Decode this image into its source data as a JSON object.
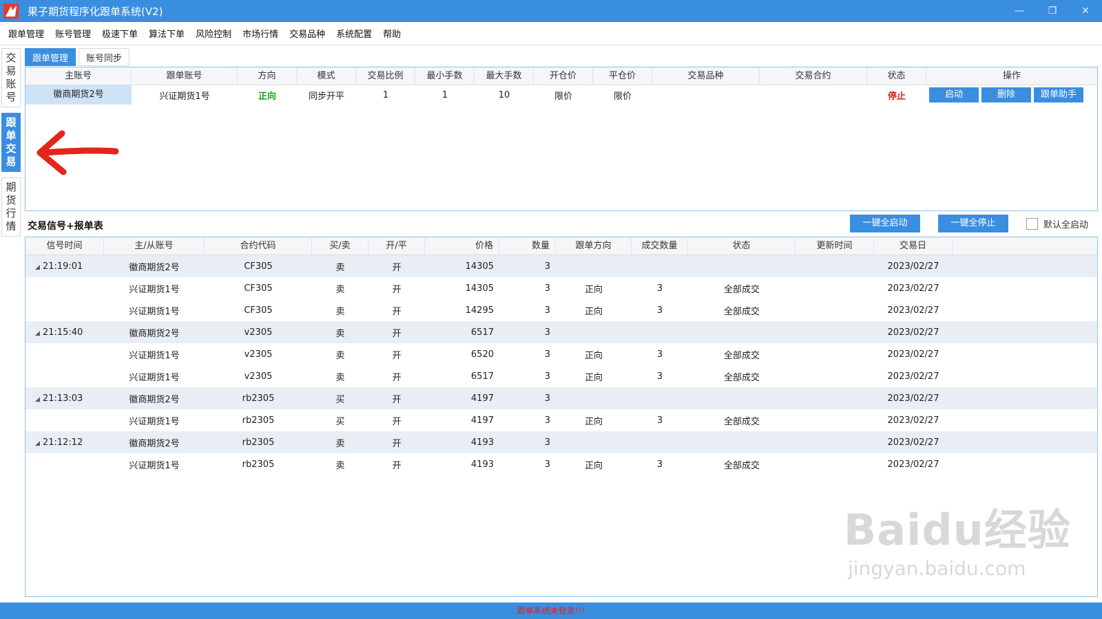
{
  "window": {
    "title": "果子期货程序化跟单系统(V2)",
    "controls": [
      "—",
      "❐",
      "✕"
    ]
  },
  "menu": [
    "跟单管理",
    "账号管理",
    "极速下单",
    "算法下单",
    "风险控制",
    "市场行情",
    "交易品种",
    "系统配置",
    "帮助"
  ],
  "sidebar": [
    {
      "label": [
        "交",
        "易",
        "账",
        "号"
      ],
      "active": false
    },
    {
      "label": [
        "跟",
        "单",
        "交",
        "易"
      ],
      "active": true
    },
    {
      "label": [
        "期",
        "货",
        "行",
        "情"
      ],
      "active": false
    }
  ],
  "tabs": [
    {
      "label": "跟单管理",
      "active": true
    },
    {
      "label": "账号同步",
      "active": false
    }
  ],
  "follow_table": {
    "headers": [
      "主账号",
      "跟单账号",
      "方向",
      "模式",
      "交易比例",
      "最小手数",
      "最大手数",
      "开仓价",
      "平仓价",
      "交易品种",
      "交易合约",
      "状态",
      "操作"
    ],
    "rows": [
      {
        "main": "徽商期货2号",
        "follow": "兴证期货1号",
        "direction": "正向",
        "mode": "同步开平",
        "ratio": "1",
        "min": "1",
        "max": "10",
        "open_price": "限价",
        "close_price": "限价",
        "product": "",
        "contract": "",
        "status": "停止"
      }
    ],
    "op_buttons": [
      "启动",
      "删除",
      "跟单助手"
    ]
  },
  "signal_section": {
    "title": "交易信号+报单表",
    "start_all": "一键全启动",
    "stop_all": "一键全停止",
    "default_start": "默认全启动"
  },
  "signal_table": {
    "headers": [
      "信号时间",
      "主/从账号",
      "合约代码",
      "买/卖",
      "开/平",
      "价格",
      "数量",
      "跟单方向",
      "成交数量",
      "状态",
      "更新时间",
      "交易日"
    ],
    "rows": [
      {
        "parent": true,
        "time": "21:19:01",
        "account": "徽商期货2号",
        "contract": "CF305",
        "bs": "卖",
        "oc": "开",
        "price": "14305",
        "qty": "3",
        "dir": "",
        "filled": "",
        "status": "",
        "update": "",
        "date": "2023/02/27"
      },
      {
        "parent": false,
        "time": "",
        "account": "兴证期货1号",
        "contract": "CF305",
        "bs": "卖",
        "oc": "开",
        "price": "14305",
        "qty": "3",
        "dir": "正向",
        "filled": "3",
        "status": "全部成交",
        "update": "",
        "date": "2023/02/27"
      },
      {
        "parent": false,
        "time": "",
        "account": "兴证期货1号",
        "contract": "CF305",
        "bs": "卖",
        "oc": "开",
        "price": "14295",
        "qty": "3",
        "dir": "正向",
        "filled": "3",
        "status": "全部成交",
        "update": "",
        "date": "2023/02/27"
      },
      {
        "parent": true,
        "time": "21:15:40",
        "account": "徽商期货2号",
        "contract": "v2305",
        "bs": "卖",
        "oc": "开",
        "price": "6517",
        "qty": "3",
        "dir": "",
        "filled": "",
        "status": "",
        "update": "",
        "date": "2023/02/27"
      },
      {
        "parent": false,
        "time": "",
        "account": "兴证期货1号",
        "contract": "v2305",
        "bs": "卖",
        "oc": "开",
        "price": "6520",
        "qty": "3",
        "dir": "正向",
        "filled": "3",
        "status": "全部成交",
        "update": "",
        "date": "2023/02/27"
      },
      {
        "parent": false,
        "time": "",
        "account": "兴证期货1号",
        "contract": "v2305",
        "bs": "卖",
        "oc": "开",
        "price": "6517",
        "qty": "3",
        "dir": "正向",
        "filled": "3",
        "status": "全部成交",
        "update": "",
        "date": "2023/02/27"
      },
      {
        "parent": true,
        "time": "21:13:03",
        "account": "徽商期货2号",
        "contract": "rb2305",
        "bs": "买",
        "oc": "开",
        "price": "4197",
        "qty": "3",
        "dir": "",
        "filled": "",
        "status": "",
        "update": "",
        "date": "2023/02/27"
      },
      {
        "parent": false,
        "time": "",
        "account": "兴证期货1号",
        "contract": "rb2305",
        "bs": "买",
        "oc": "开",
        "price": "4197",
        "qty": "3",
        "dir": "正向",
        "filled": "3",
        "status": "全部成交",
        "update": "",
        "date": "2023/02/27"
      },
      {
        "parent": true,
        "time": "21:12:12",
        "account": "徽商期货2号",
        "contract": "rb2305",
        "bs": "卖",
        "oc": "开",
        "price": "4193",
        "qty": "3",
        "dir": "",
        "filled": "",
        "status": "",
        "update": "",
        "date": "2023/02/27"
      },
      {
        "parent": false,
        "time": "",
        "account": "兴证期货1号",
        "contract": "rb2305",
        "bs": "卖",
        "oc": "开",
        "price": "4193",
        "qty": "3",
        "dir": "正向",
        "filled": "3",
        "status": "全部成交",
        "update": "",
        "date": "2023/02/27"
      }
    ]
  },
  "statusbar": {
    "text": "跟单系统未登录!!!"
  },
  "watermark": {
    "main": "Baidu经验",
    "sub": "jingyan.baidu.com"
  },
  "colors": {
    "accent": "#3a8ee0",
    "positive": "#1aa31a",
    "stopped": "#e02020"
  }
}
